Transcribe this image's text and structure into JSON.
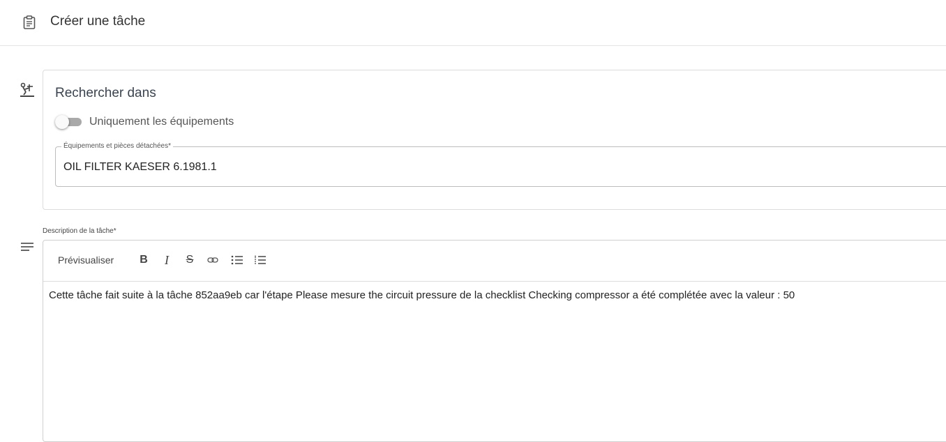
{
  "header": {
    "icon": "clipboard-icon",
    "title": "Créer une tâche"
  },
  "search_section": {
    "icon": "equipment-icon",
    "title": "Rechercher dans",
    "toggle": {
      "label": "Uniquement les équipements",
      "checked": false
    },
    "field": {
      "label": "Équipements et pièces détachées*",
      "value": "OIL FILTER KAESER 6.1981.1"
    }
  },
  "description": {
    "icon": "notes-icon",
    "label": "Description de la tâche*",
    "toolbar": {
      "preview_label": "Prévisualiser",
      "bold_label": "B",
      "italic_label": "I",
      "strike_label": "S",
      "buttons": [
        "bold-icon",
        "italic-icon",
        "strikethrough-icon",
        "link-icon",
        "bulleted-list-icon",
        "numbered-list-icon"
      ]
    },
    "text": "Cette tâche fait suite à la tâche 852aa9eb car l'étape Please mesure the circuit pressure de la checklist Checking compressor a été complétée avec la valeur : 50"
  },
  "colors": {
    "text_primary": "#333333",
    "border": "#dcdcdc",
    "toggle_track": "#a9a9a9"
  }
}
